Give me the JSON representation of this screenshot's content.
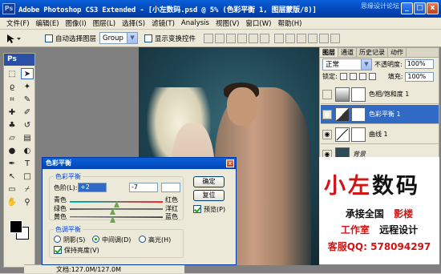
{
  "title": {
    "text": "Adobe Photoshop CS3 Extended - [小左数码.psd @ 5% (色彩平衡 1, 图层蒙版/8)]",
    "watermark": "思缘设计论坛"
  },
  "window_buttons": {
    "minimize": "_",
    "maximize": "□",
    "close": "x"
  },
  "menu": [
    "文件(F)",
    "编辑(E)",
    "图像(I)",
    "图层(L)",
    "选择(S)",
    "滤镜(T)",
    "Analysis",
    "视图(V)",
    "窗口(W)",
    "帮助(H)"
  ],
  "options_bar": {
    "auto_select_label": "自动选择图层",
    "auto_select_value": "Group",
    "show_transform_label": "显示变换控件"
  },
  "toolbox": {
    "badge": "Ps"
  },
  "status_bar": {
    "text": "文档:127.0M/127.0M"
  },
  "layers_panel": {
    "tabs": [
      "图层",
      "通道",
      "历史记录",
      "动作"
    ],
    "blend_mode": "正常",
    "opacity_label": "不透明度:",
    "opacity_value": "100%",
    "lock_label": "锁定:",
    "fill_label": "填充:",
    "fill_value": "100%",
    "layers": [
      {
        "name": "色相/饱和度 1",
        "selected": false
      },
      {
        "name": "色彩平衡 1",
        "selected": true
      },
      {
        "name": "曲线 1",
        "selected": false
      },
      {
        "name": "背景",
        "selected": false
      }
    ]
  },
  "dialog": {
    "title": "色彩平衡",
    "group1_legend": "色彩平衡",
    "levels_label": "色阶(L):",
    "level1": "+2",
    "level2": "-7",
    "level3": "",
    "left_labels": [
      "青色",
      "绿色",
      "黄色"
    ],
    "right_labels": [
      "红色",
      "洋红",
      "蓝色"
    ],
    "ok_button": "确定",
    "reset_button": "复位",
    "preview_label": "预览(P)",
    "group2_legend": "色调平衡",
    "shadows_label": "阴影(S)",
    "midtones_label": "中间调(D)",
    "highlights_label": "高光(H)",
    "preserve_label": "保持亮度(V)"
  },
  "ad": {
    "brand_red": "小左",
    "brand_black": "数码",
    "line1_black": "承接全国",
    "line1_red": "影楼",
    "line2_red": "工作室",
    "line2_black": "远程设计",
    "line3": "客服QQ: 578094297",
    "accent": "#d21414"
  }
}
